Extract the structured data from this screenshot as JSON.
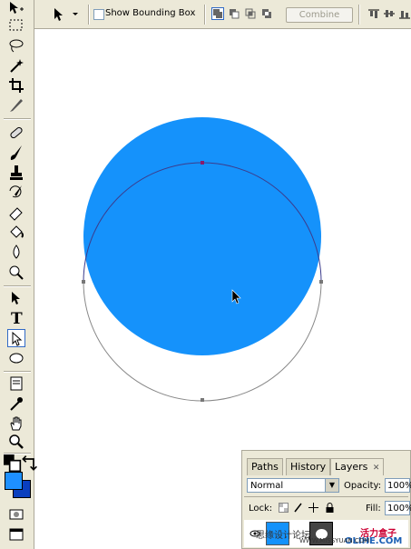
{
  "options_bar": {
    "show_bounding_box_label": "Show Bounding Box",
    "combine_label": "Combine"
  },
  "toolbox": {
    "tools": [
      "move",
      "marquee",
      "lasso",
      "magic-wand",
      "crop",
      "slice",
      "healing",
      "brush",
      "stamp",
      "history-brush",
      "eraser",
      "paint-bucket",
      "blur",
      "dodge",
      "path-selection",
      "type",
      "direct-selection",
      "ellipse",
      "notes",
      "eyedropper",
      "hand",
      "zoom"
    ],
    "type_tool_glyph": "T",
    "foreground_color": "#1e90ff",
    "background_color": "#0a3fbf"
  },
  "canvas": {
    "shape_fill": "#1592fb",
    "path_stroke": "#3c3c8c"
  },
  "layers_panel": {
    "tabs": [
      "Paths",
      "History",
      "Layers"
    ],
    "active_tab": "Layers",
    "blend_mode": "Normal",
    "opacity_label": "Opacity:",
    "opacity_value": "100%",
    "lock_label": "Lock:",
    "fill_label": "Fill:",
    "fill_value": "100%"
  },
  "watermark": {
    "left_text": "思缘设计论坛",
    "right_top": "活力盒子",
    "right_bottom": "OLIHE.COM",
    "url_text": "WWW.MISSYUAN.COM"
  }
}
